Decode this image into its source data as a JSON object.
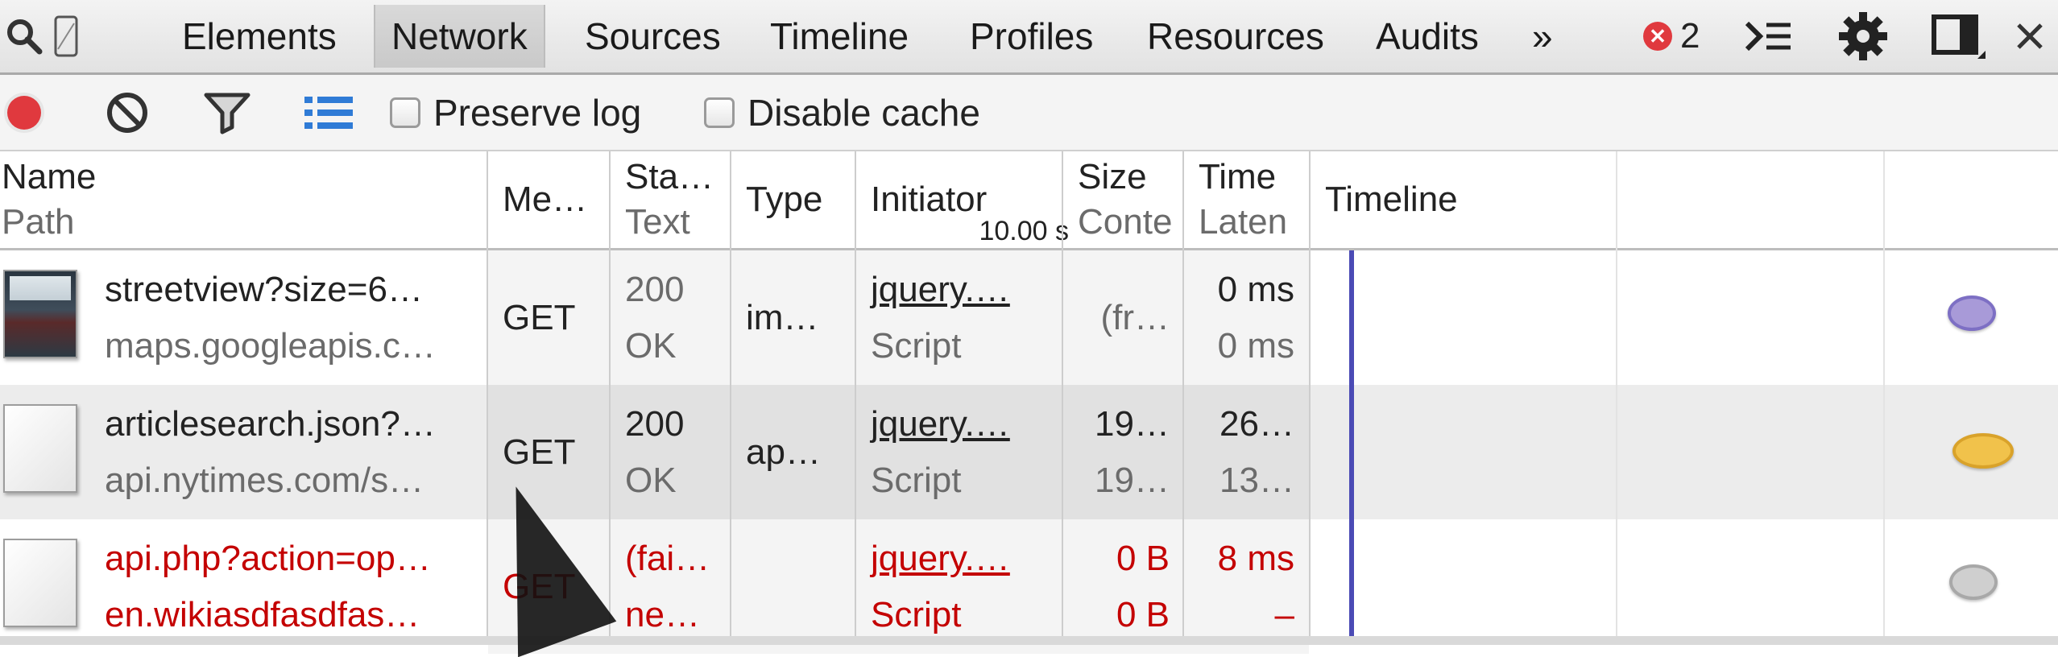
{
  "tabs": {
    "items": [
      "Elements",
      "Network",
      "Sources",
      "Timeline",
      "Profiles",
      "Resources",
      "Audits"
    ],
    "more": "»",
    "selected": "Network",
    "error_count": "2"
  },
  "toolbar": {
    "preserve_log": "Preserve log",
    "disable_cache": "Disable cache"
  },
  "columns": {
    "name": {
      "title": "Name",
      "sub": "Path"
    },
    "method": {
      "title": "Me…"
    },
    "status": {
      "title": "Sta…",
      "sub": "Text"
    },
    "type": {
      "title": "Type"
    },
    "initiator": {
      "title": "Initiator"
    },
    "size": {
      "title": "Size",
      "sub": "Conte"
    },
    "time": {
      "title": "Time",
      "sub": "Laten"
    },
    "timeline": {
      "title": "Timeline",
      "tick": "10.00 s"
    }
  },
  "rows": [
    {
      "name": "streetview?size=6…",
      "path": "maps.googleapis.c…",
      "method": "GET",
      "status": "200",
      "status_text": "OK",
      "type": "im…",
      "initiator": "jquery.…",
      "initiator_type": "Script",
      "size": "(fr…",
      "content": "",
      "time": "0 ms",
      "latency": "0 ms",
      "error": false
    },
    {
      "name": "articlesearch.json?…",
      "path": "api.nytimes.com/s…",
      "method": "GET",
      "status": "200",
      "status_text": "OK",
      "type": "ap…",
      "initiator": "jquery.…",
      "initiator_type": "Script",
      "size": "19…",
      "content": "19…",
      "time": "26…",
      "latency": "13…",
      "error": false
    },
    {
      "name": "api.php?action=op…",
      "path": "en.wikiasdfasdfas…",
      "method": "GET",
      "status": "(fai…",
      "status_text": "ne…",
      "type": "",
      "initiator": "jquery.…",
      "initiator_type": "Script",
      "size": "0 B",
      "content": "0 B",
      "time": "8 ms",
      "latency": "–",
      "error": true
    }
  ],
  "colors": {
    "record": "#e0393e",
    "error_text": "#c40000",
    "timeline_line": "#4b4bb5",
    "bubble_image": "#a89ad8",
    "bubble_xhr": "#f1c24b",
    "bubble_failed": "#cfcfcf"
  }
}
